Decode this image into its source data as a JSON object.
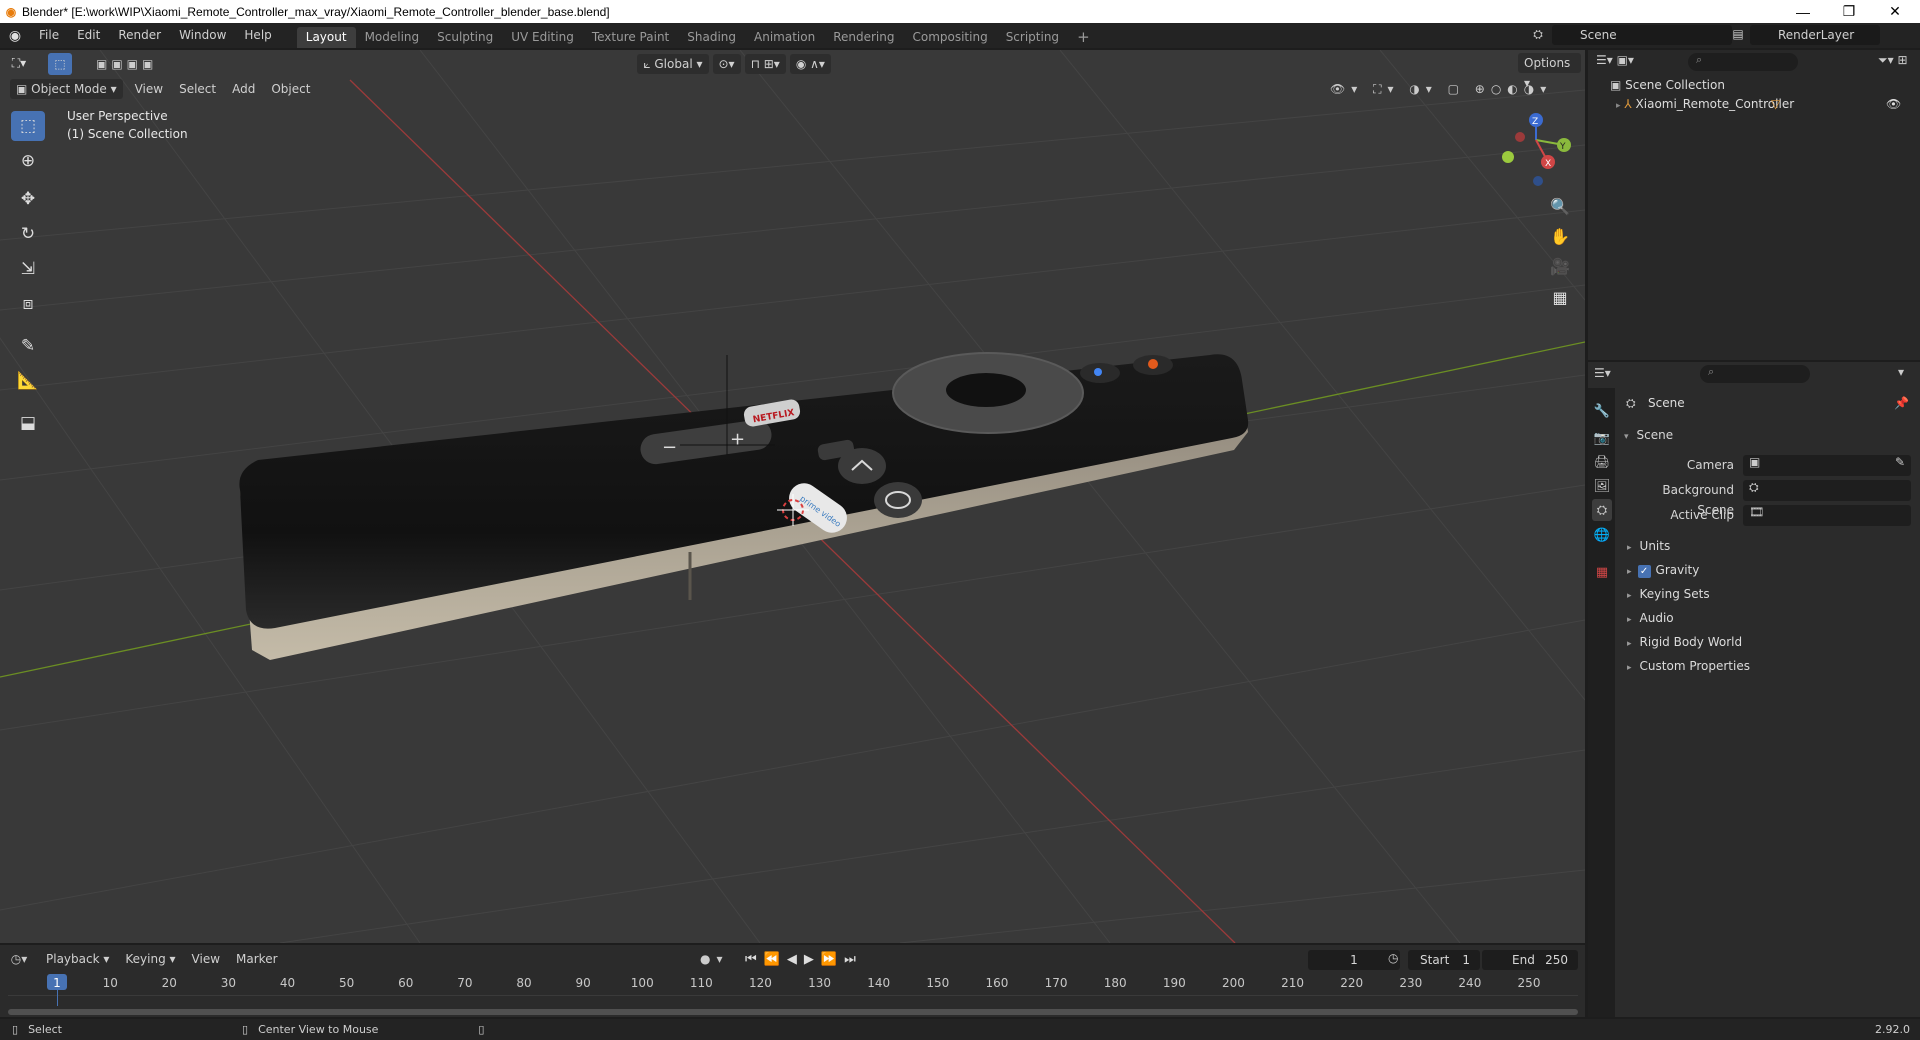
{
  "window": {
    "title": "Blender* [E:\\work\\WIP\\Xiaomi_Remote_Controller_max_vray/Xiaomi_Remote_Controller_blender_base.blend]",
    "controls": [
      "—",
      "❐",
      "✕"
    ]
  },
  "menubar": {
    "items": [
      "File",
      "Edit",
      "Render",
      "Window",
      "Help"
    ],
    "workspaces": [
      "Layout",
      "Modeling",
      "Sculpting",
      "UV Editing",
      "Texture Paint",
      "Shading",
      "Animation",
      "Rendering",
      "Compositing",
      "Scripting"
    ],
    "active_workspace": "Layout",
    "add_tab": "+",
    "scene": "Scene",
    "view_layer": "RenderLayer"
  },
  "viewport": {
    "transform_orientation": "Global",
    "options_label": "Options",
    "mode": "Object Mode",
    "menus": [
      "View",
      "Select",
      "Add",
      "Object"
    ],
    "overlay_line1": "User Perspective",
    "overlay_line2": "(1) Scene Collection",
    "gizmo": {
      "x": "X",
      "y": "Y",
      "z": "Z"
    },
    "object_button_labels": [
      "−",
      "+",
      "NETFLIX",
      "prime video"
    ]
  },
  "outliner": {
    "collection": "Scene Collection",
    "object": "Xiaomi_Remote_Controller"
  },
  "properties": {
    "header": "Scene",
    "section": "Scene",
    "fields": [
      {
        "label": "Camera"
      },
      {
        "label": "Background Scene"
      },
      {
        "label": "Active Clip"
      }
    ],
    "subpanels": [
      "Units",
      "Gravity",
      "Keying Sets",
      "Audio",
      "Rigid Body World",
      "Custom Properties"
    ],
    "gravity_checked": true
  },
  "timeline": {
    "menus": [
      "Playback",
      "Keying",
      "View",
      "Marker"
    ],
    "current_frame": "1",
    "start_label": "Start",
    "start_value": "1",
    "end_label": "End",
    "end_value": "250",
    "ruler": [
      "1",
      "10",
      "20",
      "30",
      "40",
      "50",
      "60",
      "70",
      "80",
      "90",
      "100",
      "110",
      "120",
      "130",
      "140",
      "150",
      "160",
      "170",
      "180",
      "190",
      "200",
      "210",
      "220",
      "230",
      "240",
      "250"
    ]
  },
  "statusbar": {
    "left": "Select",
    "middle": "Center View to Mouse",
    "version": "2.92.0"
  }
}
